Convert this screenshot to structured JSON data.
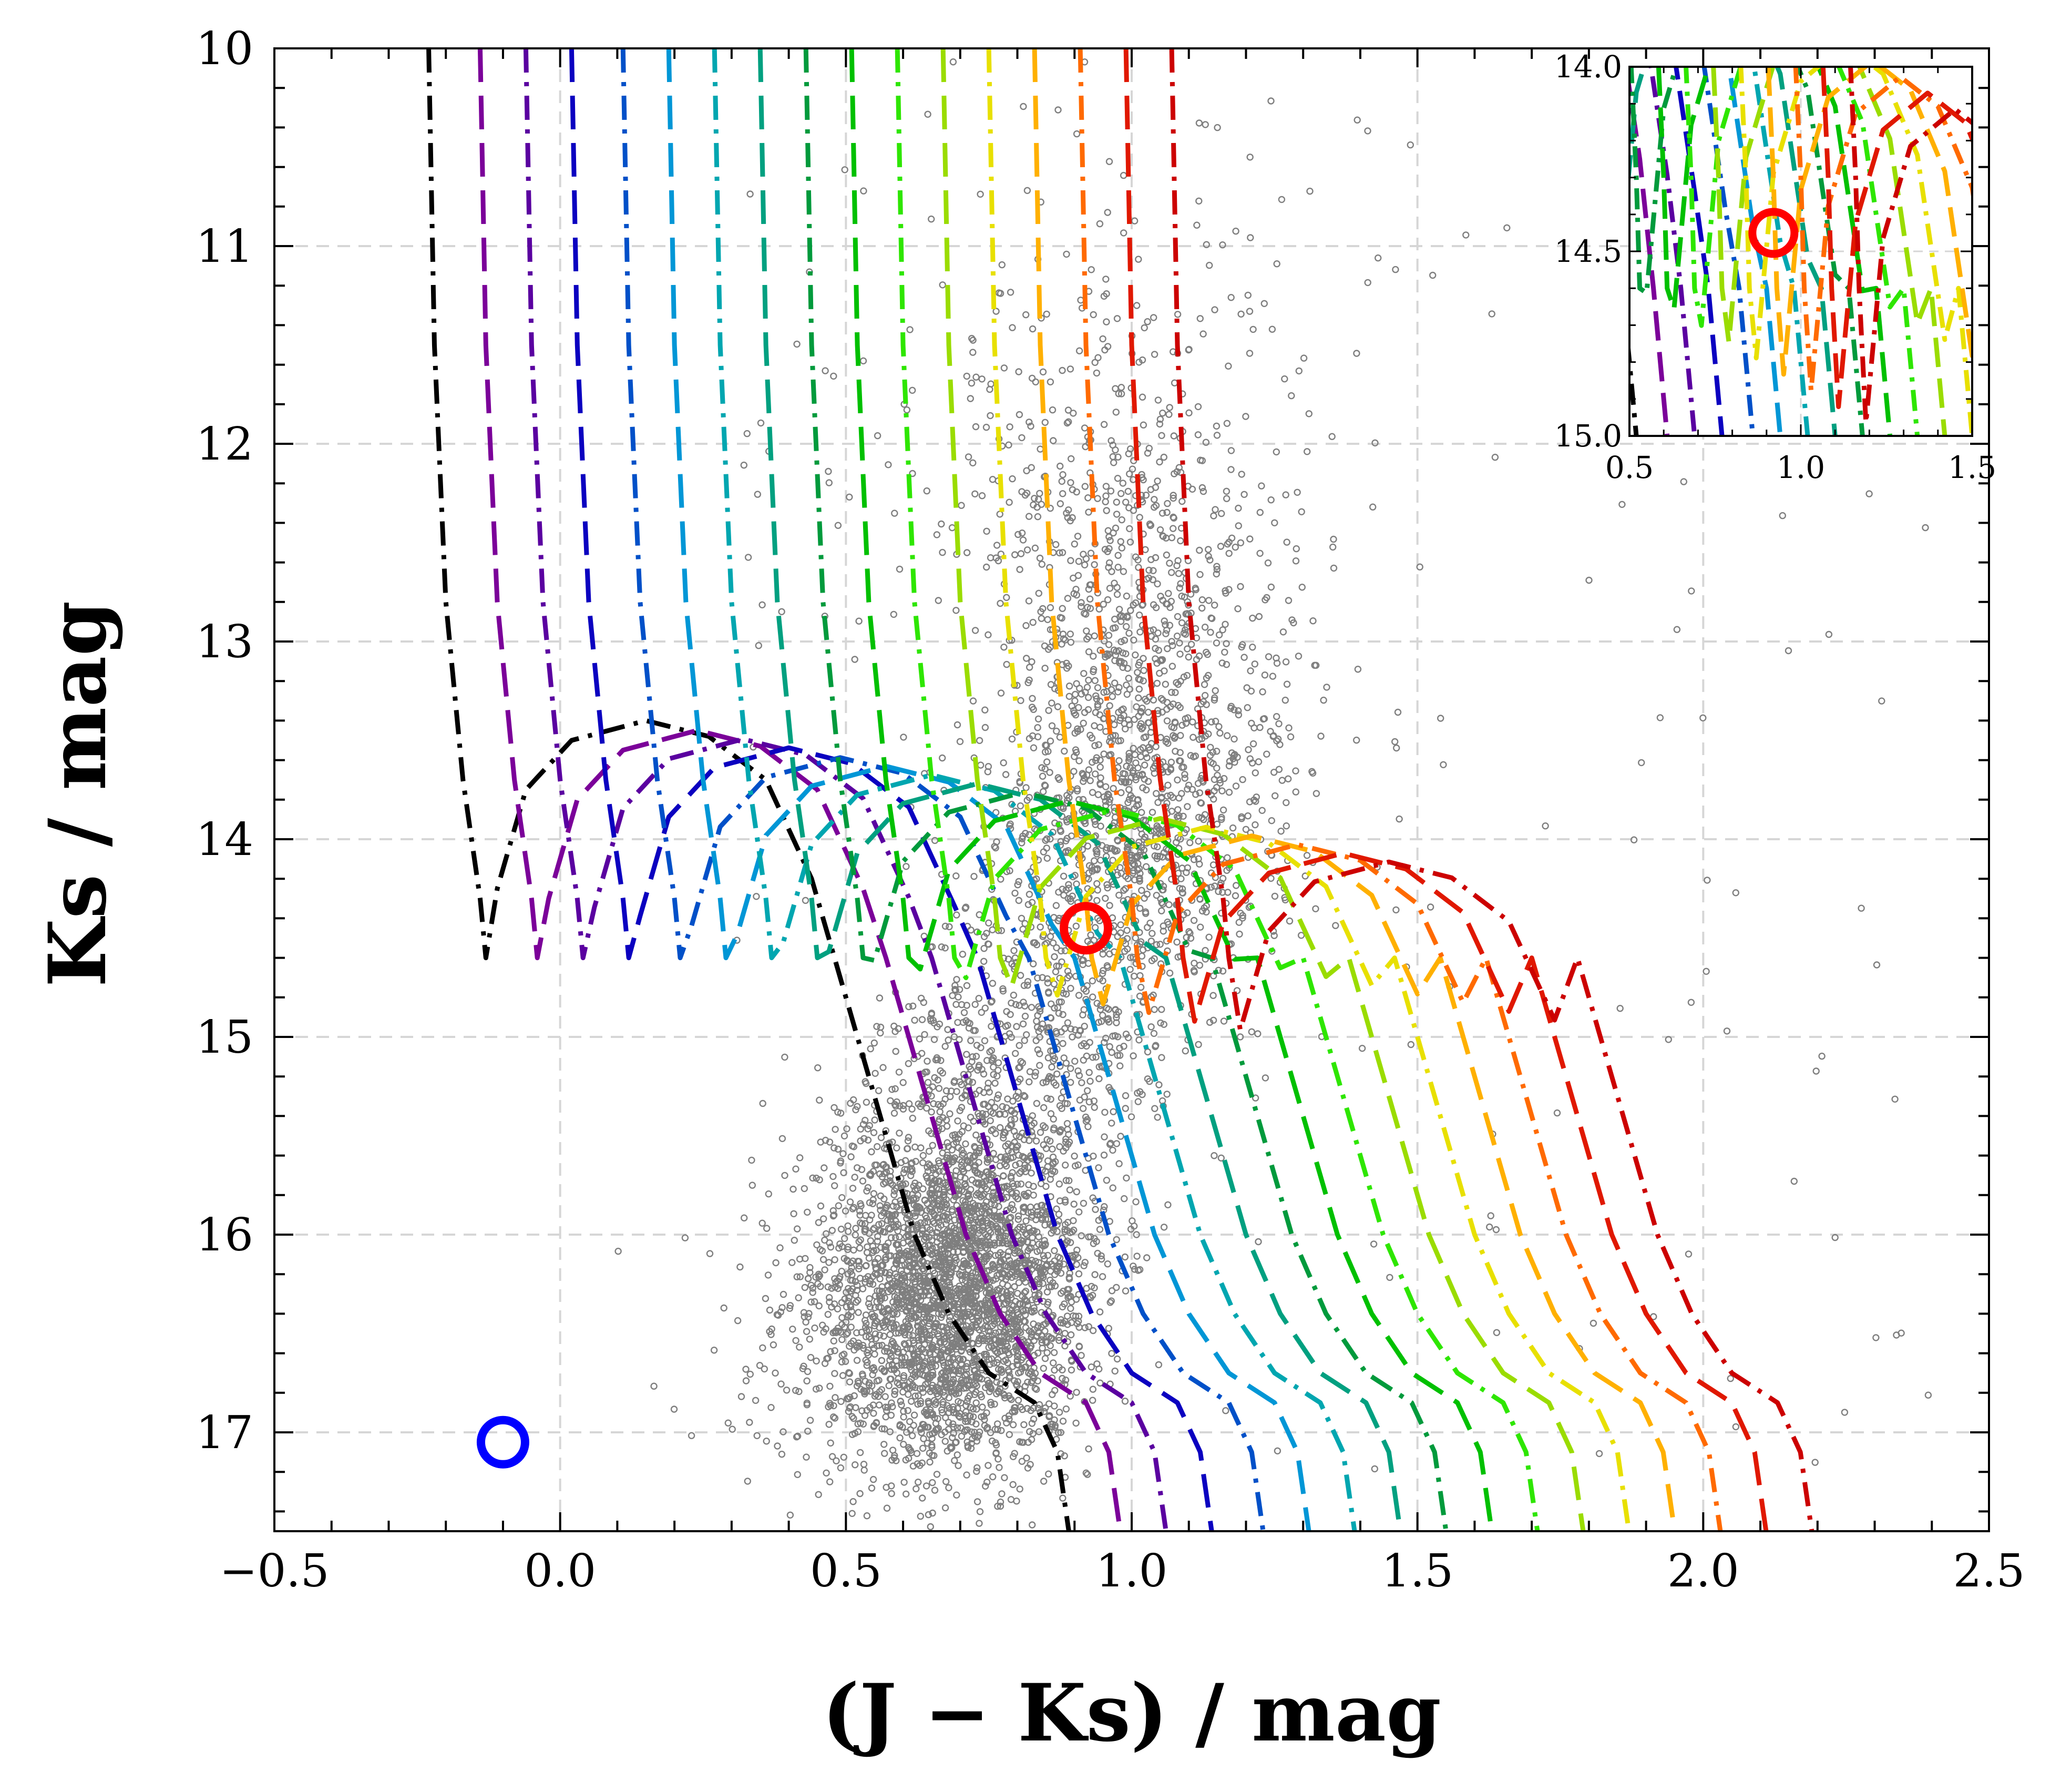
{
  "chart_data": {
    "type": "scatter",
    "xlabel": "(J − Ks) / mag",
    "ylabel": "Ks / mag",
    "xlim": [
      -0.5,
      2.5
    ],
    "ylim": [
      17.5,
      10
    ],
    "y_inverted": true,
    "grid": true,
    "grid_style": "dashed light gray",
    "x_ticks": [
      -0.5,
      0.0,
      0.5,
      1.0,
      1.5,
      2.0,
      2.5
    ],
    "x_tick_labels": [
      "−0.5",
      "0.0",
      "0.5",
      "1.0",
      "1.5",
      "2.0",
      "2.5"
    ],
    "y_ticks": [
      10,
      11,
      12,
      13,
      14,
      15,
      16,
      17
    ],
    "y_tick_labels": [
      "10",
      "11",
      "12",
      "13",
      "14",
      "15",
      "16",
      "17"
    ],
    "scatter_color": "#7f7f7f",
    "track_model": {
      "description": "vertical pre-main-sequence tracks turning into a hook and a diagonal main-sequence; each entry is shifted by its color offset",
      "line_style": "dash-dot / long-dash alternating",
      "offsets": [
        {
          "dx": 0.0,
          "color": "#000000"
        },
        {
          "dx": 0.09,
          "color": "#7b0099"
        },
        {
          "dx": 0.17,
          "color": "#5a00a0"
        },
        {
          "dx": 0.25,
          "color": "#0b00c0"
        },
        {
          "dx": 0.34,
          "color": "#0050c8"
        },
        {
          "dx": 0.42,
          "color": "#0096d6"
        },
        {
          "dx": 0.5,
          "color": "#00a6b0"
        },
        {
          "dx": 0.58,
          "color": "#00a080"
        },
        {
          "dx": 0.66,
          "color": "#009a3c"
        },
        {
          "dx": 0.74,
          "color": "#00c000"
        },
        {
          "dx": 0.82,
          "color": "#2ee600"
        },
        {
          "dx": 0.9,
          "color": "#9adc00"
        },
        {
          "dx": 0.98,
          "color": "#e8e000"
        },
        {
          "dx": 1.06,
          "color": "#ffb000"
        },
        {
          "dx": 1.14,
          "color": "#ff6a00"
        },
        {
          "dx": 1.22,
          "color": "#e01800"
        },
        {
          "dx": 1.3,
          "color": "#cc0000"
        }
      ],
      "base_curve": [
        [
          -0.23,
          10.0
        ],
        [
          -0.22,
          11.5
        ],
        [
          -0.2,
          12.8
        ],
        [
          -0.17,
          13.7
        ],
        [
          -0.14,
          14.3
        ],
        [
          -0.13,
          14.6
        ],
        [
          -0.11,
          14.25
        ],
        [
          -0.06,
          13.75
        ],
        [
          0.02,
          13.5
        ],
        [
          0.15,
          13.4
        ],
        [
          0.26,
          13.48
        ],
        [
          0.36,
          13.7
        ],
        [
          0.44,
          14.2
        ],
        [
          0.48,
          14.6
        ],
        [
          0.52,
          15.0
        ],
        [
          0.57,
          15.5
        ],
        [
          0.62,
          16.0
        ],
        [
          0.68,
          16.4
        ],
        [
          0.75,
          16.7
        ],
        [
          0.83,
          16.85
        ],
        [
          0.87,
          17.1
        ],
        [
          0.89,
          17.5
        ]
      ]
    },
    "highlighted_points": [
      {
        "x": 0.92,
        "y": 14.45,
        "color": "#ff0000"
      },
      {
        "x": -0.1,
        "y": 17.05,
        "color": "#0000ff"
      }
    ],
    "inset": {
      "xlim": [
        0.5,
        1.5
      ],
      "ylim": [
        15.0,
        14.0
      ],
      "x_ticks": [
        0.5,
        1.0,
        1.5
      ],
      "x_tick_labels": [
        "0.5",
        "1.0",
        "1.5"
      ],
      "y_ticks": [
        14.0,
        14.5,
        15.0
      ],
      "y_tick_labels": [
        "14.0",
        "14.5",
        "15.0"
      ],
      "highlight": {
        "x": 0.92,
        "y": 14.45,
        "color": "#ff0000"
      }
    }
  }
}
